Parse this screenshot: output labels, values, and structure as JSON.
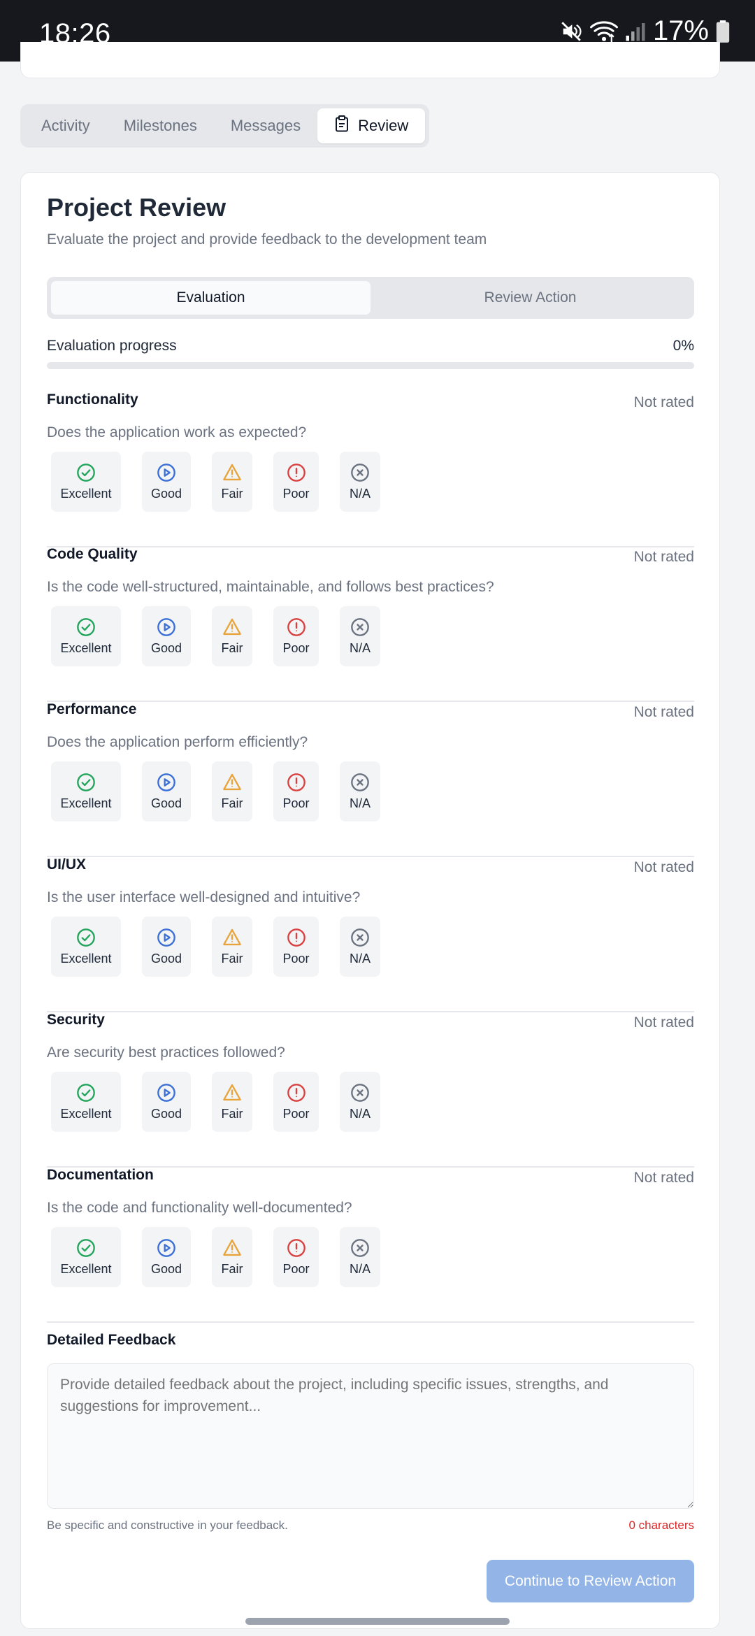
{
  "status_bar": {
    "time": "18:26",
    "battery": "17%"
  },
  "tabs": [
    {
      "label": "Activity",
      "active": false
    },
    {
      "label": "Milestones",
      "active": false
    },
    {
      "label": "Messages",
      "active": false
    },
    {
      "label": "Review",
      "active": true,
      "icon": "clipboard-icon"
    }
  ],
  "review": {
    "title": "Project Review",
    "subtitle": "Evaluate the project and provide feedback to the development team",
    "segments": [
      {
        "label": "Evaluation",
        "active": true
      },
      {
        "label": "Review Action",
        "active": false
      }
    ],
    "progress": {
      "label": "Evaluation progress",
      "value_text": "0%",
      "fraction": 0
    },
    "rating_options": [
      {
        "label": "Excellent",
        "icon": "check-circle-icon",
        "color": "#22a55b"
      },
      {
        "label": "Good",
        "icon": "play-circle-icon",
        "color": "#3b6fd6"
      },
      {
        "label": "Fair",
        "icon": "warning-triangle-icon",
        "color": "#e8a33a"
      },
      {
        "label": "Poor",
        "icon": "alert-circle-icon",
        "color": "#d94141"
      },
      {
        "label": "N/A",
        "icon": "x-circle-icon",
        "color": "#6b7280"
      }
    ],
    "criteria": [
      {
        "name": "Functionality",
        "status": "Not rated",
        "question": "Does the application work as expected?"
      },
      {
        "name": "Code Quality",
        "status": "Not rated",
        "question": "Is the code well-structured, maintainable, and follows best practices?"
      },
      {
        "name": "Performance",
        "status": "Not rated",
        "question": "Does the application perform efficiently?"
      },
      {
        "name": "UI/UX",
        "status": "Not rated",
        "question": "Is the user interface well-designed and intuitive?"
      },
      {
        "name": "Security",
        "status": "Not rated",
        "question": "Are security best practices followed?"
      },
      {
        "name": "Documentation",
        "status": "Not rated",
        "question": "Is the code and functionality well-documented?"
      }
    ],
    "feedback": {
      "label": "Detailed Feedback",
      "placeholder": "Provide detailed feedback about the project, including specific issues, strengths, and suggestions for improvement...",
      "value": "",
      "help": "Be specific and constructive in your feedback.",
      "count": "0 characters"
    },
    "continue_label": "Continue to Review Action"
  }
}
